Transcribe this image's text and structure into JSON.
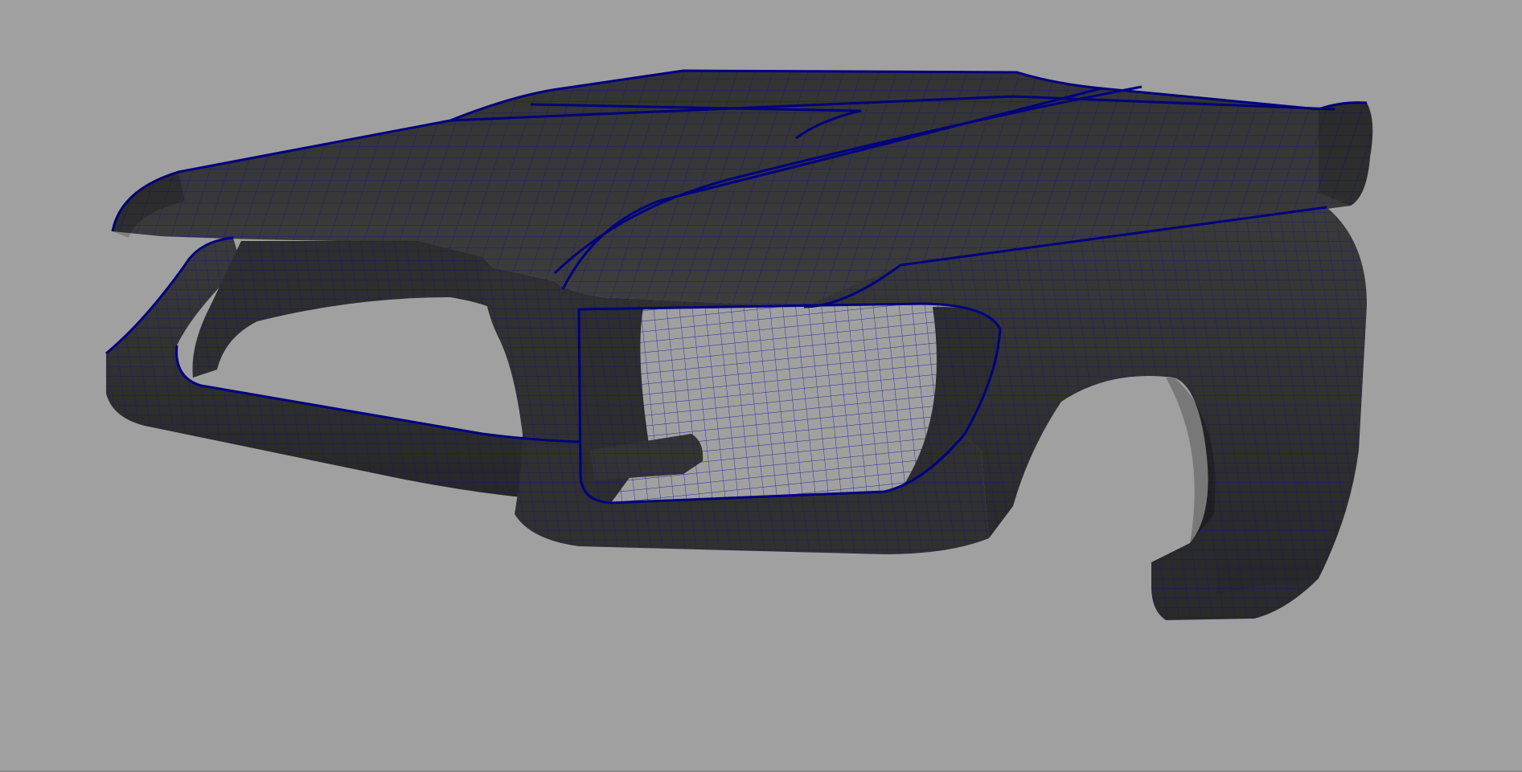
{
  "viewport": {
    "background_color": "#a0a0a0",
    "shading": "smooth-shade-with-wireframe",
    "mesh_color": "#2b2b2b",
    "mesh_shadow_color": "#1c1c1c",
    "mesh_highlight_color": "#454545",
    "wireframe_color": "#0a0a8c",
    "selection_edge_color": "#000080",
    "see_through_opening_color": "#a0a0a0"
  },
  "model": {
    "object_icon": "polygon-mesh-icon",
    "description_visible": false
  }
}
